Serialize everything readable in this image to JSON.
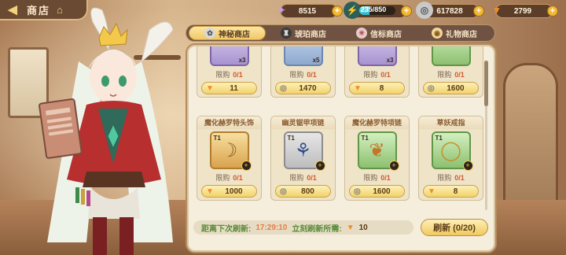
{
  "header": {
    "title": "商店"
  },
  "currencies": [
    {
      "name": "gem",
      "value": "8515",
      "icon": "crystal-icon",
      "color": "#b88cff"
    },
    {
      "name": "stamina",
      "value": "235/850",
      "icon": "stamina-icon",
      "fill": 0.28
    },
    {
      "name": "coin",
      "value": "617828",
      "icon": "coin-icon"
    },
    {
      "name": "carrot",
      "value": "2799",
      "icon": "carrot-icon"
    }
  ],
  "tabs": [
    {
      "label": "神秘商店",
      "active": true
    },
    {
      "label": "琥珀商店",
      "active": false
    },
    {
      "label": "信标商店",
      "active": false
    },
    {
      "label": "礼物商店",
      "active": false
    }
  ],
  "top_row": [
    {
      "qty": "x3",
      "limit_label": "限购",
      "limit": "0/1",
      "price": "11",
      "currency": "carrot"
    },
    {
      "qty": "x5",
      "limit_label": "限购",
      "limit": "0/1",
      "price": "1470",
      "currency": "coin"
    },
    {
      "qty": "x3",
      "limit_label": "限购",
      "limit": "0/1",
      "price": "8",
      "currency": "carrot"
    },
    {
      "qty": "",
      "limit_label": "限购",
      "limit": "0/1",
      "price": "1600",
      "currency": "coin"
    }
  ],
  "items": [
    {
      "name": "魔化赫罗特头饰",
      "tier": "T1",
      "limit_label": "限购",
      "limit": "0/1",
      "price": "1000",
      "currency": "carrot",
      "rarity": "gold"
    },
    {
      "name": "幽灵锯甲项链",
      "tier": "T1",
      "limit_label": "限购",
      "limit": "0/1",
      "price": "800",
      "currency": "coin",
      "rarity": "gray"
    },
    {
      "name": "魔化赫罗特项链",
      "tier": "T1",
      "limit_label": "限购",
      "limit": "0/1",
      "price": "1600",
      "currency": "coin",
      "rarity": "green"
    },
    {
      "name": "草妖戒指",
      "tier": "T1",
      "limit_label": "限购",
      "limit": "0/1",
      "price": "8",
      "currency": "carrot",
      "rarity": "green"
    }
  ],
  "refresh": {
    "label": "距离下次刷新:",
    "timer": "17:29:10",
    "cost_label": "立刻刷新所需:",
    "cost": "10",
    "button": "刷新 (0/20)"
  }
}
